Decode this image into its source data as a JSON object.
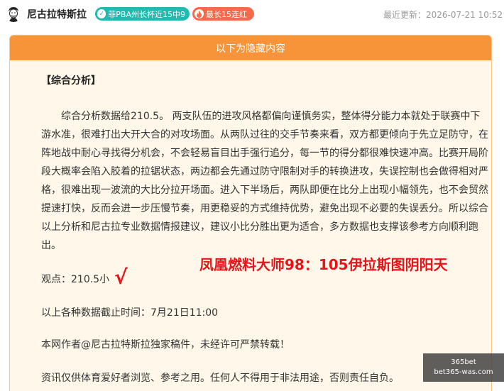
{
  "header": {
    "author": "尼古拉特斯拉",
    "badges": [
      {
        "text": "菲PBA州长杯近15中9",
        "icon": "check-circle-icon",
        "color": "#21b9b0"
      },
      {
        "text": "最长15连红",
        "icon": "flame-icon",
        "color": "#f56b4a"
      }
    ],
    "updated": "最近更新：2026-07-21 10:52"
  },
  "card": {
    "title": "以下为隐藏内容",
    "section_title": "【综合分析】",
    "paragraph": "综合分析数据给210.5。 两支队伍的进攻风格都偏向谨慎务实，整体得分能力本就处于联赛中下游水准，很难打出大开大合的对攻场面。从两队过往的交手节奏来看，双方都更倾向于先立足防守，在阵地战中耐心寻找得分机会，不会轻易盲目出手强行追分，每一节的得分都很难快速冲高。比赛开局阶段大概率会陷入胶着的拉锯状态，两边都会先通过防守限制对手的转换进攻，失误控制也会做得相对严格，很难出现一波流的大比分拉开场面。进入下半场后，两队即便在比分上出现小幅领先，也不会贸然提速打快，反而会进一步压慢节奏，用更稳妥的方式维持优势，避免出现不必要的失误丢分。所以综合以上分析和尼古拉专业数据情报建议，建议小比分胜出更为适合，多方数据也支撑该参考方向顺利跑出。",
    "viewpoint": "观点：210.5小",
    "check_mark": "√",
    "promo": "凤凰燃料大师98：105伊拉斯图阴阳天",
    "cutoff": "以上各种数据截止时间：7月21日11:00",
    "copyright": "本网作者@尼古拉特斯拉独家稿件，未经许可严禁转载！",
    "disclaimer": "资讯仅供体育爱好者浏览、参考之用。任何人不得用于非法用途，否则责任自负。"
  },
  "watermark": {
    "line1": "365bet",
    "line2": "bet365-was.com"
  },
  "colors": {
    "accent": "#f7943a",
    "card_bg": "#fff8ea",
    "promo": "#e8141a"
  }
}
